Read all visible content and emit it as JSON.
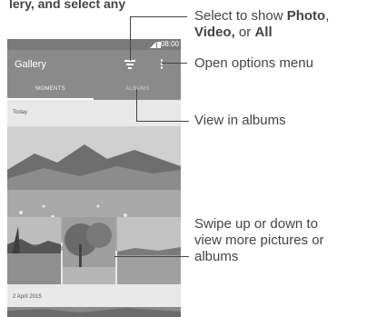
{
  "top_caption": "lery, and select any",
  "status": {
    "time": "08:00"
  },
  "app": {
    "title": "Gallery",
    "tabs": [
      {
        "label": "MOMENTS"
      },
      {
        "label": "ALBUMS"
      }
    ]
  },
  "sections": [
    {
      "label": "Today"
    },
    {
      "label": "2 April 2015"
    }
  ],
  "icons": {
    "filter": "filter-icon",
    "more": "more-options-icon",
    "signal": "signal-icon",
    "battery": "battery-icon"
  },
  "callouts": {
    "filter": {
      "prefix": "Select to show ",
      "b1": "Photo",
      "sep1": ",",
      "b2": "Video,",
      "mid": " or ",
      "b3": "All"
    },
    "options": {
      "text": "Open options menu"
    },
    "albums": {
      "text": "View in albums"
    },
    "swipe": {
      "text": "Swipe up or down to view more pictures or albums"
    }
  }
}
